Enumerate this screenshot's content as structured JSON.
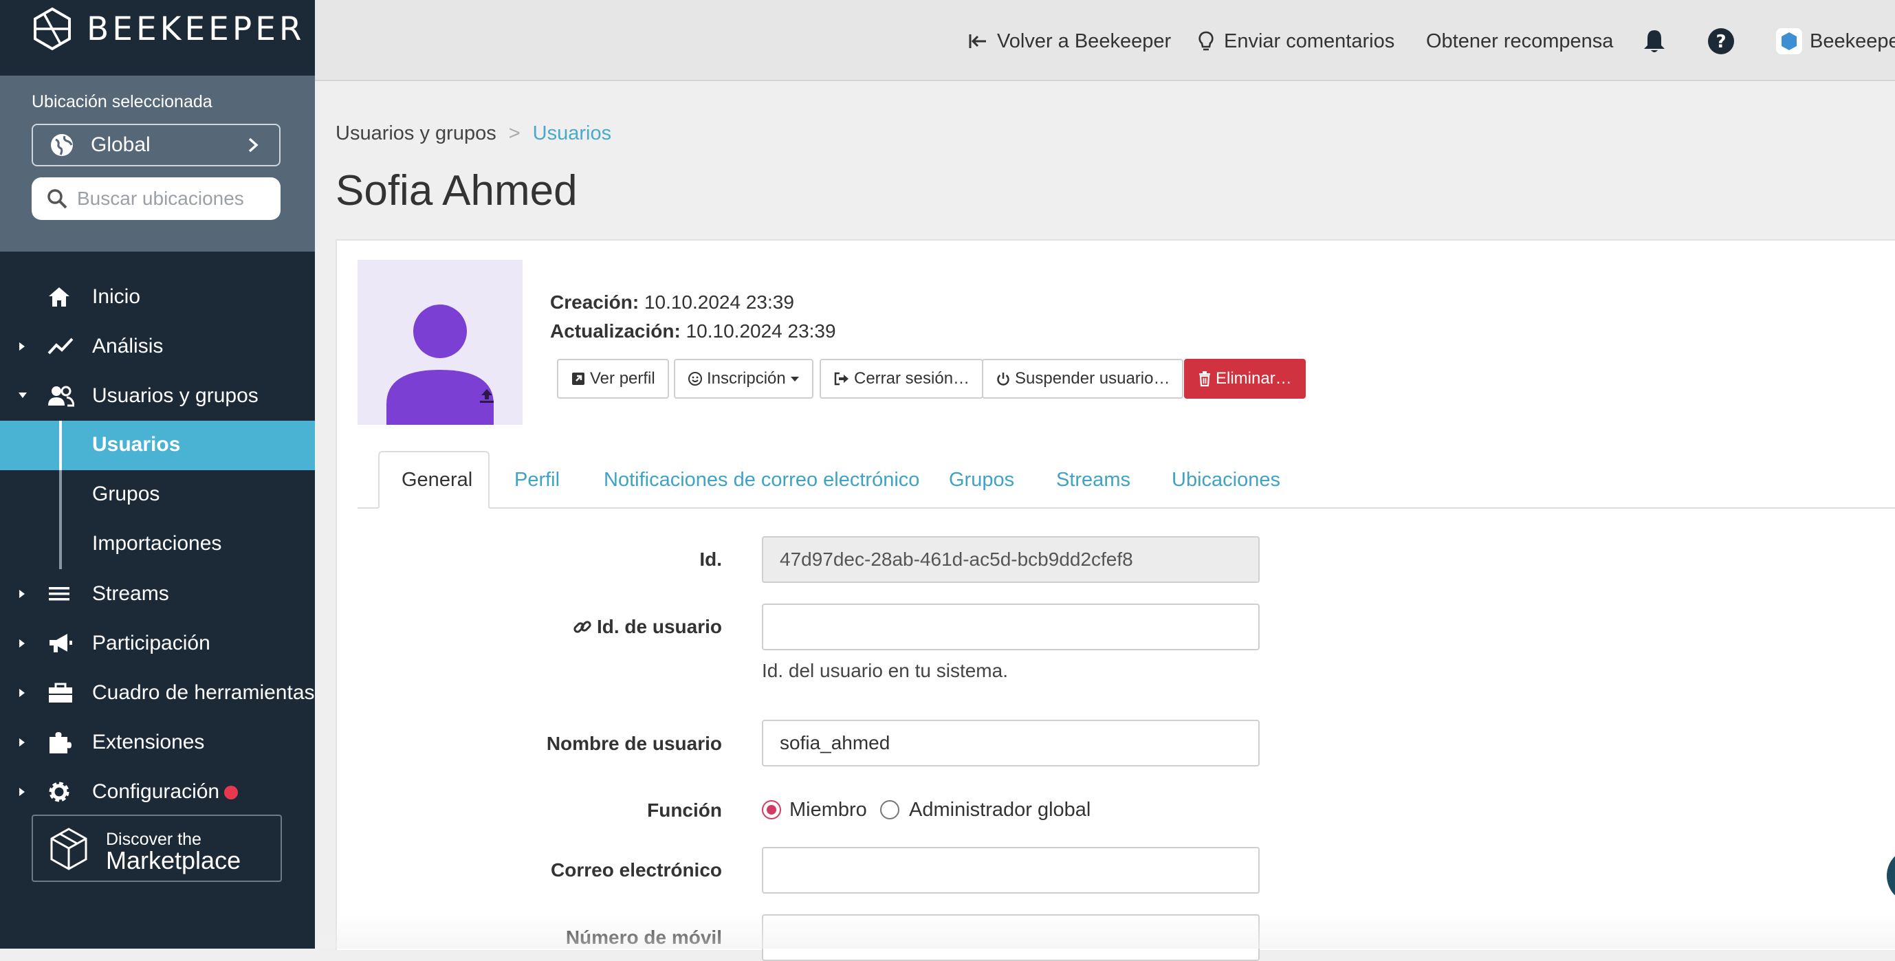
{
  "app": {
    "logo_text": "BEEKEEPER"
  },
  "location": {
    "label": "Ubicación seleccionada",
    "selected": "Global",
    "search_placeholder": "Buscar ubicaciones"
  },
  "sidebar": {
    "items": [
      {
        "label": "Inicio",
        "icon": "home-icon"
      },
      {
        "label": "Análisis",
        "icon": "chart-line-icon"
      },
      {
        "label": "Usuarios y grupos",
        "icon": "users-icon"
      },
      {
        "label": "Streams",
        "icon": "list-icon"
      },
      {
        "label": "Participación",
        "icon": "megaphone-icon"
      },
      {
        "label": "Cuadro de herramientas",
        "icon": "toolbox-icon"
      },
      {
        "label": "Extensiones",
        "icon": "puzzle-icon"
      },
      {
        "label": "Configuración",
        "icon": "gear-icon"
      }
    ],
    "subitems": [
      {
        "label": "Usuarios",
        "active": true
      },
      {
        "label": "Grupos",
        "active": false
      },
      {
        "label": "Importaciones",
        "active": false
      }
    ],
    "marketplace": {
      "line1": "Discover the",
      "line2": "Marketplace"
    }
  },
  "topbar": {
    "back": "Volver a Beekeeper",
    "feedback": "Enviar comentarios",
    "reward": "Obtener recompensa",
    "account": "Beekeeper"
  },
  "breadcrumb": {
    "root": "Usuarios y grupos",
    "separator": ">",
    "current": "Usuarios"
  },
  "user": {
    "name": "Sofia Ahmed",
    "created_label": "Creación:",
    "created": "10.10.2024 23:39",
    "updated_label": "Actualización:",
    "updated": "10.10.2024 23:39"
  },
  "actions": {
    "view_profile": "Ver perfil",
    "enrollment": "Inscripción",
    "logout": "Cerrar sesión…",
    "suspend": "Suspender usuario…",
    "delete": "Eliminar…"
  },
  "tabs": [
    "General",
    "Perfil",
    "Notificaciones de correo electrónico",
    "Grupos",
    "Streams",
    "Ubicaciones"
  ],
  "form": {
    "id_label": "Id.",
    "id_value": "47d97dec-28ab-461d-ac5d-bcb9dd2cfef8",
    "user_id_label": "Id. de usuario",
    "user_id_value": "",
    "user_id_help": "Id. del usuario en tu sistema.",
    "username_label": "Nombre de usuario",
    "username_value": "sofia_ahmed",
    "role_label": "Función",
    "role_options": [
      "Miembro",
      "Administrador global"
    ],
    "role_selected": "Miembro",
    "email_label": "Correo electrónico",
    "email_value": "",
    "mobile_label": "Número de móvil",
    "mobile_value": ""
  },
  "colors": {
    "sidebar_bg": "#1c2a38",
    "location_panel_bg": "#566878",
    "active_item_bg": "#4ab3d4",
    "link": "#3ea3c4",
    "danger": "#d0323f",
    "radio_selected": "#d23c64",
    "avatar_bg": "#ece8f7",
    "avatar_fg": "#7b3fd4",
    "notification_dot": "#e8384f"
  }
}
